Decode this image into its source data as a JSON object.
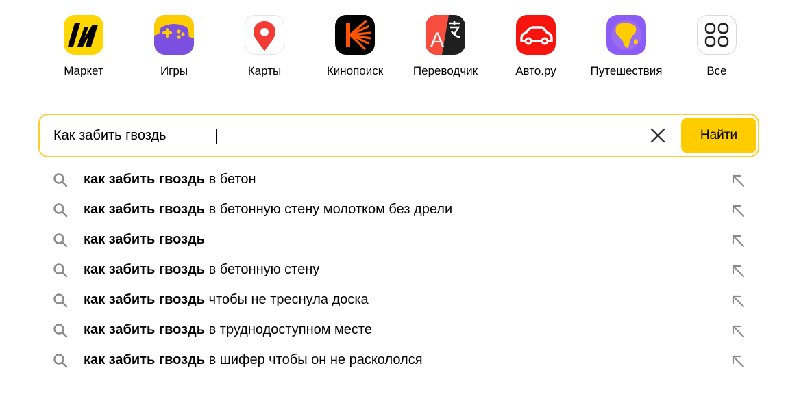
{
  "services": [
    {
      "label": "Маркет",
      "icon": "market-icon"
    },
    {
      "label": "Игры",
      "icon": "games-icon"
    },
    {
      "label": "Карты",
      "icon": "maps-icon"
    },
    {
      "label": "Кинопоиск",
      "icon": "kinopoisk-icon"
    },
    {
      "label": "Переводчик",
      "icon": "translator-icon"
    },
    {
      "label": "Авто.ру",
      "icon": "autoru-icon"
    },
    {
      "label": "Путешествия",
      "icon": "travel-icon"
    },
    {
      "label": "Все",
      "icon": "all-services-icon"
    }
  ],
  "search": {
    "value": "Как забить гвоздь",
    "button_label": "Найти",
    "clear_icon": "close-icon"
  },
  "suggestions": [
    {
      "bold": "как забить гвоздь",
      "rest": " в бетон"
    },
    {
      "bold": "как забить гвоздь",
      "rest": " в бетонную стену молотком без дрели"
    },
    {
      "bold": "как забить гвоздь",
      "rest": ""
    },
    {
      "bold": "как забить гвоздь",
      "rest": " в бетонную стену"
    },
    {
      "bold": "как забить гвоздь",
      "rest": " чтобы не треснула доска"
    },
    {
      "bold": "как забить гвоздь",
      "rest": " в труднодоступном месте"
    },
    {
      "bold": "как забить гвоздь",
      "rest": " в шифер чтобы он не раскололся"
    }
  ],
  "colors": {
    "accent": "#ffcc00",
    "search_border": "#ffcc33",
    "icon_gray": "#8a8a8a"
  }
}
